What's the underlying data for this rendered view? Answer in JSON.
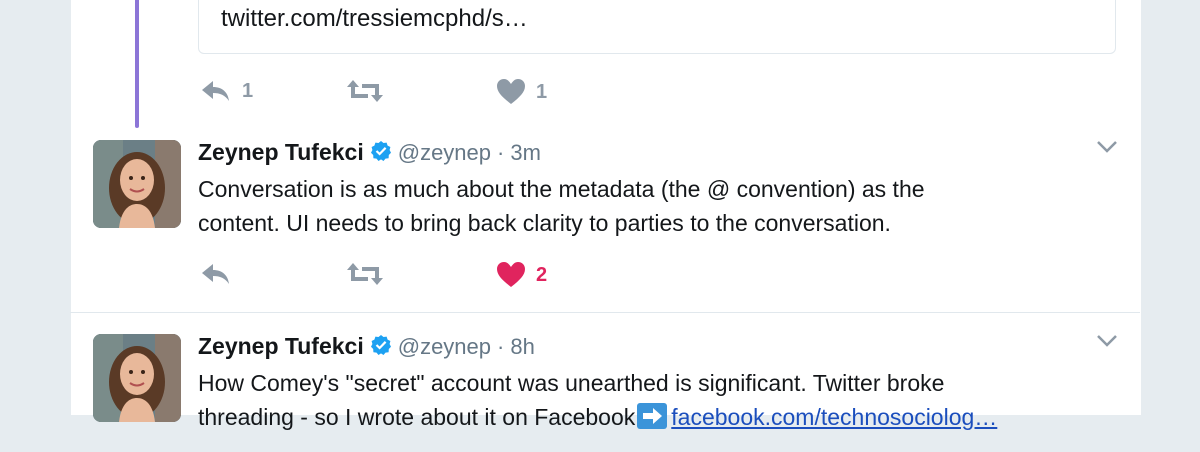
{
  "quoted": {
    "link_text": "twitter.com/tressiemcphd/s…"
  },
  "quoted_actions": {
    "reply_count": "1",
    "retweet_count": "",
    "like_count": "1"
  },
  "tweets": [
    {
      "name": "Zeynep Tufekci",
      "handle": "@zeynep",
      "separator": "·",
      "time": "3m",
      "text_lines": [
        "Conversation is as much about the metadata (the @ convention) as the",
        "content. UI needs to bring back clarity to parties to the conversation."
      ],
      "reply_count": "",
      "retweet_count": "",
      "like_count": "2"
    },
    {
      "name": "Zeynep Tufekci",
      "handle": "@zeynep",
      "separator": "·",
      "time": "8h",
      "text_line1": "How Comey's \"secret\" account was unearthed is significant. Twitter broke",
      "text_line2_prefix": "threading - so I wrote about it on Facebook",
      "link_text": "facebook.com/technosociolog…"
    }
  ],
  "colors": {
    "thread_line": "#8c75d7",
    "like_active": "#e0245e",
    "verified": "#1da1f2",
    "icon_gray": "#8e9aa6"
  }
}
